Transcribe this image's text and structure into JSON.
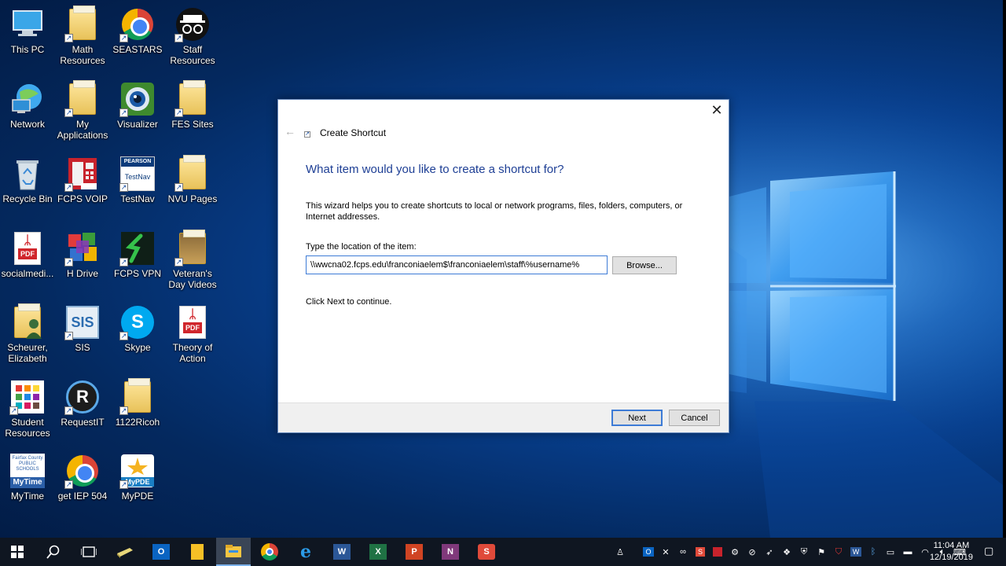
{
  "desktop_icons": [
    {
      "label": "This PC",
      "icon": "computer-icon"
    },
    {
      "label": "Math Resources",
      "icon": "folder-icon"
    },
    {
      "label": "SEASTARS",
      "icon": "chrome-icon"
    },
    {
      "label": "Staff Resources",
      "icon": "spy-icon"
    },
    {
      "label": "Network",
      "icon": "network-icon"
    },
    {
      "label": "My Applications",
      "icon": "folder-icon"
    },
    {
      "label": "Visualizer",
      "icon": "visualizer-icon"
    },
    {
      "label": "FES Sites",
      "icon": "folder-icon"
    },
    {
      "label": "Recycle Bin",
      "icon": "recycle-bin-icon"
    },
    {
      "label": "FCPS VOIP",
      "icon": "phone-icon"
    },
    {
      "label": "TestNav",
      "icon": "testnav-icon"
    },
    {
      "label": "NVU Pages",
      "icon": "folder-icon"
    },
    {
      "label": "socialmedi...",
      "icon": "pdf-icon"
    },
    {
      "label": "H Drive",
      "icon": "drive-icon"
    },
    {
      "label": "FCPS VPN",
      "icon": "vpn-icon"
    },
    {
      "label": "Veteran's Day Videos",
      "icon": "folder-icon"
    },
    {
      "label": "Scheurer, Elizabeth",
      "icon": "user-folder-icon"
    },
    {
      "label": "SIS",
      "icon": "sis-icon"
    },
    {
      "label": "Skype",
      "icon": "skype-icon"
    },
    {
      "label": "Theory of Action",
      "icon": "pdf-icon"
    },
    {
      "label": "Student Resources",
      "icon": "grid-icon"
    },
    {
      "label": "RequestIT",
      "icon": "requestit-icon"
    },
    {
      "label": "1122Ricoh",
      "icon": "folder-icon"
    },
    {
      "label": "MyTime",
      "icon": "mytime-icon"
    },
    {
      "label": "get IEP 504",
      "icon": "chrome-icon"
    },
    {
      "label": "MyPDE",
      "icon": "mypde-icon"
    }
  ],
  "icon_text": {
    "pdf": "PDF",
    "testnav_brand": "PEARSON",
    "testnav_name": "TestNav",
    "sis": "SIS",
    "skype": "S",
    "requestit": "R",
    "mytime_top": "Fairfax County",
    "mytime_sub": "PUBLIC SCHOOLS",
    "mytime_name": "MyTime",
    "mypde": "MyPDE",
    "fcps": "FCPS"
  },
  "dialog": {
    "title": "Create Shortcut",
    "heading": "What item would you like to create a shortcut for?",
    "description": "This wizard helps you to create shortcuts to local or network programs, files, folders, computers, or Internet addresses.",
    "location_label": "Type the location of the item:",
    "location_value": "\\\\wwcna02.fcps.edu\\franconiaelem$\\franconiaelem\\staff\\%username%",
    "browse_label": "Browse...",
    "hint": "Click Next to continue.",
    "next_label": "Next",
    "cancel_label": "Cancel"
  },
  "taskbar": {
    "apps": [
      "start-icon",
      "search-icon",
      "task-view-icon",
      "sticky-icon",
      "outlook-icon",
      "keep-icon",
      "file-explorer-icon",
      "chrome-icon",
      "internet-explorer-icon",
      "word-icon",
      "excel-icon",
      "powerpoint-icon",
      "onenote-icon",
      "snagit-icon"
    ],
    "app_letters": {
      "outlook": "O",
      "word": "W",
      "excel": "X",
      "powerpoint": "P",
      "onenote": "N",
      "snagit": "S",
      "ie": "e"
    },
    "clock_time": "11:04 AM",
    "clock_date": "12/19/2019"
  },
  "colors": {
    "accent": "#3d7bd6",
    "heading": "#1e3f95",
    "taskbar": "#0f1621"
  }
}
